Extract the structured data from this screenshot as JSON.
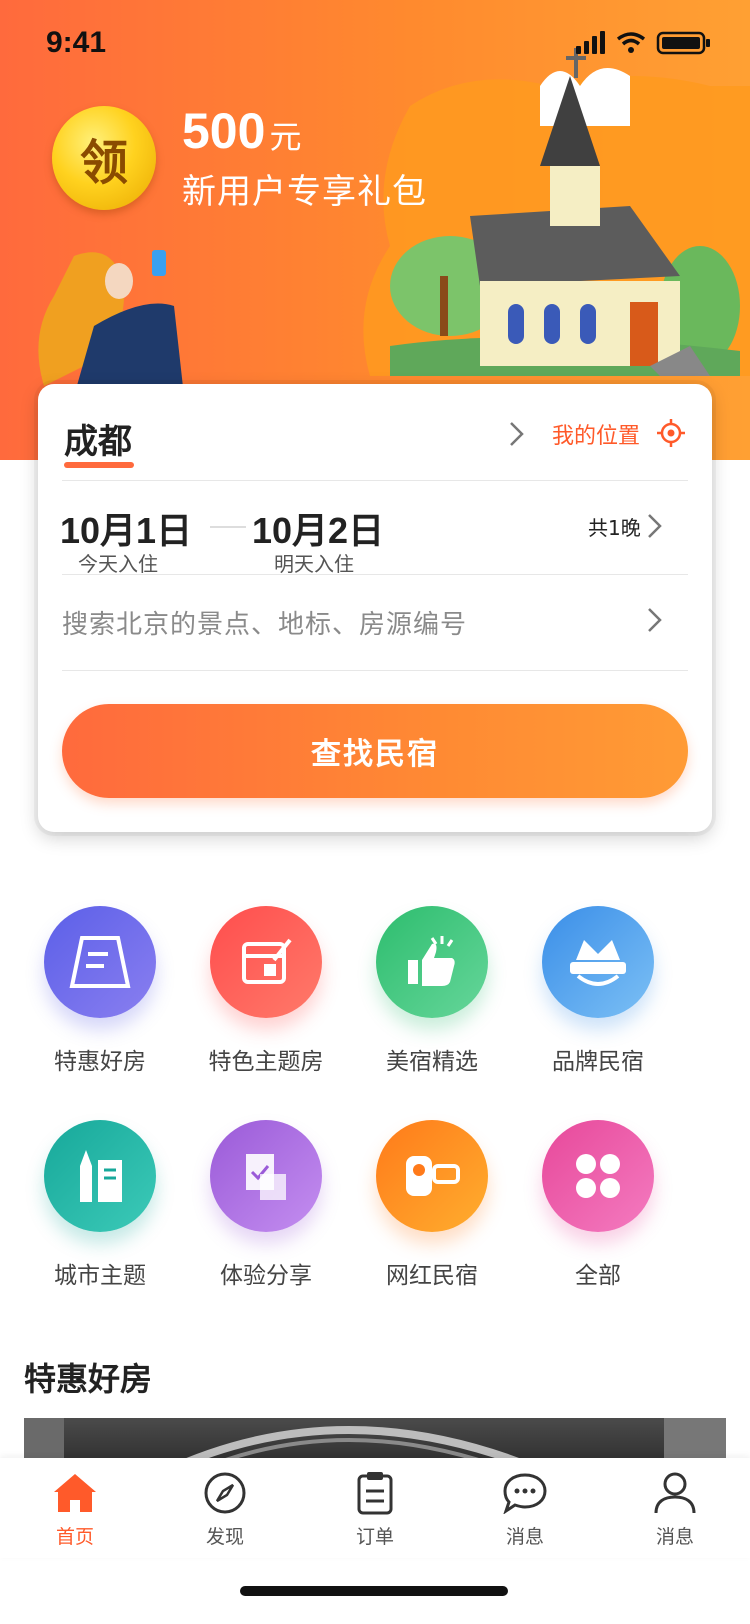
{
  "status_bar": {
    "time": "9:41"
  },
  "promo": {
    "coin_text": "领",
    "amount": "500",
    "unit": "元",
    "subtitle": "新用户专享礼包"
  },
  "search_card": {
    "city": "成都",
    "location_label": "我的位置",
    "checkin_date": "10月1日",
    "checkin_note": "今天入住",
    "checkout_date": "10月2日",
    "checkout_note": "明天入住",
    "nights": "共1晚",
    "search_placeholder": "搜索北京的景点、地标、房源编号",
    "search_button": "查找民宿"
  },
  "categories": [
    {
      "label": "特惠好房",
      "icon": "signboard-icon",
      "colors": [
        "#5b5fe8",
        "#8a7ff0"
      ]
    },
    {
      "label": "特色主题房",
      "icon": "calendar-edit-icon",
      "colors": [
        "#ff4d4d",
        "#ff7a6a"
      ]
    },
    {
      "label": "美宿精选",
      "icon": "thumbs-up-icon",
      "colors": [
        "#2dbd6e",
        "#66d69a"
      ]
    },
    {
      "label": "品牌民宿",
      "icon": "crown-icon",
      "colors": [
        "#3a8ee8",
        "#7cc0f5"
      ]
    },
    {
      "label": "城市主题",
      "icon": "city-buildings-icon",
      "colors": [
        "#17a89a",
        "#3ccab8"
      ]
    },
    {
      "label": "体验分享",
      "icon": "share-doc-icon",
      "colors": [
        "#9a5ad8",
        "#c48ef0"
      ]
    },
    {
      "label": "网红民宿",
      "icon": "camera-icon",
      "colors": [
        "#ff7a1a",
        "#ffae2e"
      ]
    },
    {
      "label": "全部",
      "icon": "clover-icon",
      "colors": [
        "#e7489a",
        "#f47bc0"
      ]
    }
  ],
  "section": {
    "title": "特惠好房"
  },
  "tabs": [
    {
      "label": "首页",
      "icon": "home-icon",
      "active": true
    },
    {
      "label": "发现",
      "icon": "compass-icon",
      "active": false
    },
    {
      "label": "订单",
      "icon": "clipboard-icon",
      "active": false
    },
    {
      "label": "消息",
      "icon": "chat-bubble-icon",
      "active": false
    },
    {
      "label": "消息",
      "icon": "user-icon",
      "active": false
    }
  ],
  "colors": {
    "accent": "#ff6a3d",
    "accent_text": "#ff5a2a"
  }
}
